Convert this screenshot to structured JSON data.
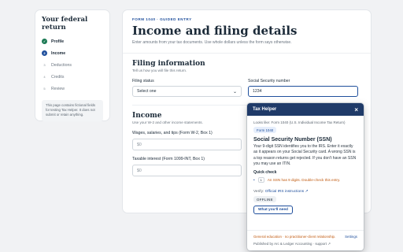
{
  "steps": {
    "title": "Your federal return",
    "items": [
      {
        "num": "✓",
        "label": "Profile",
        "state": "done"
      },
      {
        "num": "2",
        "label": "Income",
        "state": "active"
      },
      {
        "num": "3",
        "label": "Deductions",
        "state": "pending"
      },
      {
        "num": "4",
        "label": "Credits",
        "state": "pending"
      },
      {
        "num": "5",
        "label": "Review",
        "state": "pending"
      }
    ],
    "note": "This page contains fictional fields for testing Tax Helper. It does not submit or retain anything."
  },
  "main": {
    "eyebrow": "FORM 1040 · GUIDED ENTRY",
    "title": "Income and filing details",
    "subtitle": "Enter amounts from your tax documents. Use whole dollars unless the form says otherwise."
  },
  "filing": {
    "title": "Filing information",
    "desc": "Tell us how you will file this return.",
    "status_label": "Filing status",
    "status_value": "Select one",
    "ssn_label": "Social Security number",
    "ssn_value": "1234"
  },
  "income": {
    "title": "Income",
    "desc": "Use your W-2 and other income statements.",
    "wages_label": "Wages, salaries, and tips (Form W-2, Box 1)",
    "wages_placeholder": "$0",
    "interest_label": "Taxable interest (Form 1099-INT, Box 1)",
    "interest_placeholder": "$0"
  },
  "helper": {
    "title": "Tax Helper",
    "close": "×",
    "looks_like": "Looks like: Form 1040 (U.S. Individual Income Tax Return)",
    "form_chip": "Form 1040",
    "heading": "Social Security Number (SSN)",
    "body": "Your 9-digit SSN identifies you to the IRS. Enter it exactly as it appears on your Social Security card. A wrong SSN is a top reason returns get rejected. If you don't have an SSN you may use an ITIN.",
    "quick_check_label": "Quick check",
    "check_num": "1",
    "check_text": "An SSN has 9 digits. Double-check this entry.",
    "verify_prefix": "Verify:",
    "verify_link": "Official IRS instructions ↗",
    "offline": "OFFLINE",
    "need_button": "What you'll need",
    "disclaimer": "General education · no practitioner-client relationship.",
    "settings": "Settings",
    "published": "Published by Arc & Ledger Accounting · support ↗"
  },
  "colors": {
    "accent": "#1f4f9c",
    "helper_bar": "#1f3a68",
    "success": "#1d7a55",
    "warning": "#c05a10"
  }
}
